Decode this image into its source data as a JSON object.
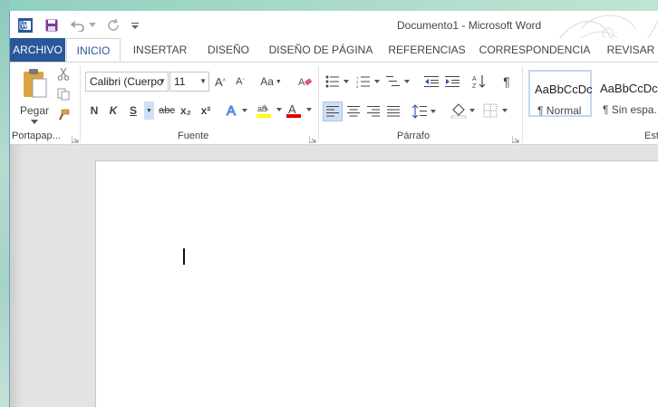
{
  "window": {
    "title": "Documento1 - Microsoft Word"
  },
  "quick_access": {
    "icons": [
      "word-app-icon",
      "save-icon",
      "undo-icon",
      "redo-icon",
      "customize-qat-icon"
    ]
  },
  "tabs": [
    {
      "label": "ARCHIVO"
    },
    {
      "label": "INICIO"
    },
    {
      "label": "INSERTAR"
    },
    {
      "label": "DISEÑO"
    },
    {
      "label": "DISEÑO DE PÁGINA"
    },
    {
      "label": "REFERENCIAS"
    },
    {
      "label": "CORRESPONDENCIA"
    },
    {
      "label": "REVISAR"
    }
  ],
  "ribbon": {
    "clipboard": {
      "paste_label": "Pegar",
      "group_label": "Portapap..."
    },
    "font": {
      "font_name": "Calibri (Cuerpo",
      "font_size": "11",
      "bold": "N",
      "italic": "K",
      "underline": "S",
      "strike": "abc",
      "subscript": "x₂",
      "superscript": "x²",
      "change_case": "Aa",
      "group_label": "Fuente"
    },
    "paragraph": {
      "group_label": "Párrafo"
    },
    "styles": {
      "items": [
        {
          "sample": "AaBbCcDc",
          "name": "¶ Normal"
        },
        {
          "sample": "AaBbCcDc",
          "name": "¶ Sin espa..."
        }
      ],
      "group_label": "Est"
    }
  },
  "colors": {
    "accent": "#2b579a",
    "highlight": "#ffff00",
    "font_color": "#e00000"
  }
}
